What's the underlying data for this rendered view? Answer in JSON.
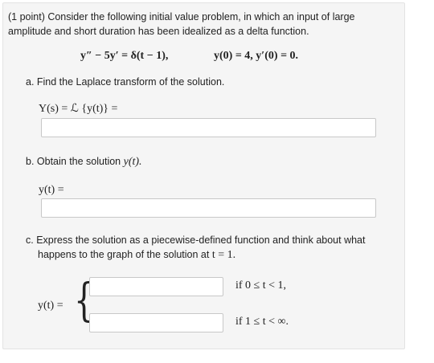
{
  "problem": {
    "intro_line1": "(1 point) Consider the following initial value problem, in which an input of large",
    "intro_line2": "amplitude and short duration has been idealized as a delta function.",
    "ode": "y″ − 5y′ = δ(t − 1),",
    "ics": "y(0) = 4,   y′(0) = 0."
  },
  "part_a": {
    "prompt": "a. Find the Laplace transform of the solution.",
    "label": "Y(s) = ℒ {y(t)} =",
    "answer_value": ""
  },
  "part_b": {
    "prompt_prefix": "b. Obtain the solution",
    "prompt_math": "y(t).",
    "label": "y(t) =",
    "answer_value": ""
  },
  "part_c": {
    "prompt_line1": "c. Express the solution as a piecewise-defined function and think about what",
    "prompt_line2_prefix": "happens to the graph of the solution at",
    "prompt_line2_math": "t = 1.",
    "label": "y(t) =",
    "brace": "{",
    "case1_condition": "if 0 ≤ t < 1,",
    "case2_condition": "if 1 ≤ t < ∞.",
    "case1_value": "",
    "case2_value": ""
  }
}
